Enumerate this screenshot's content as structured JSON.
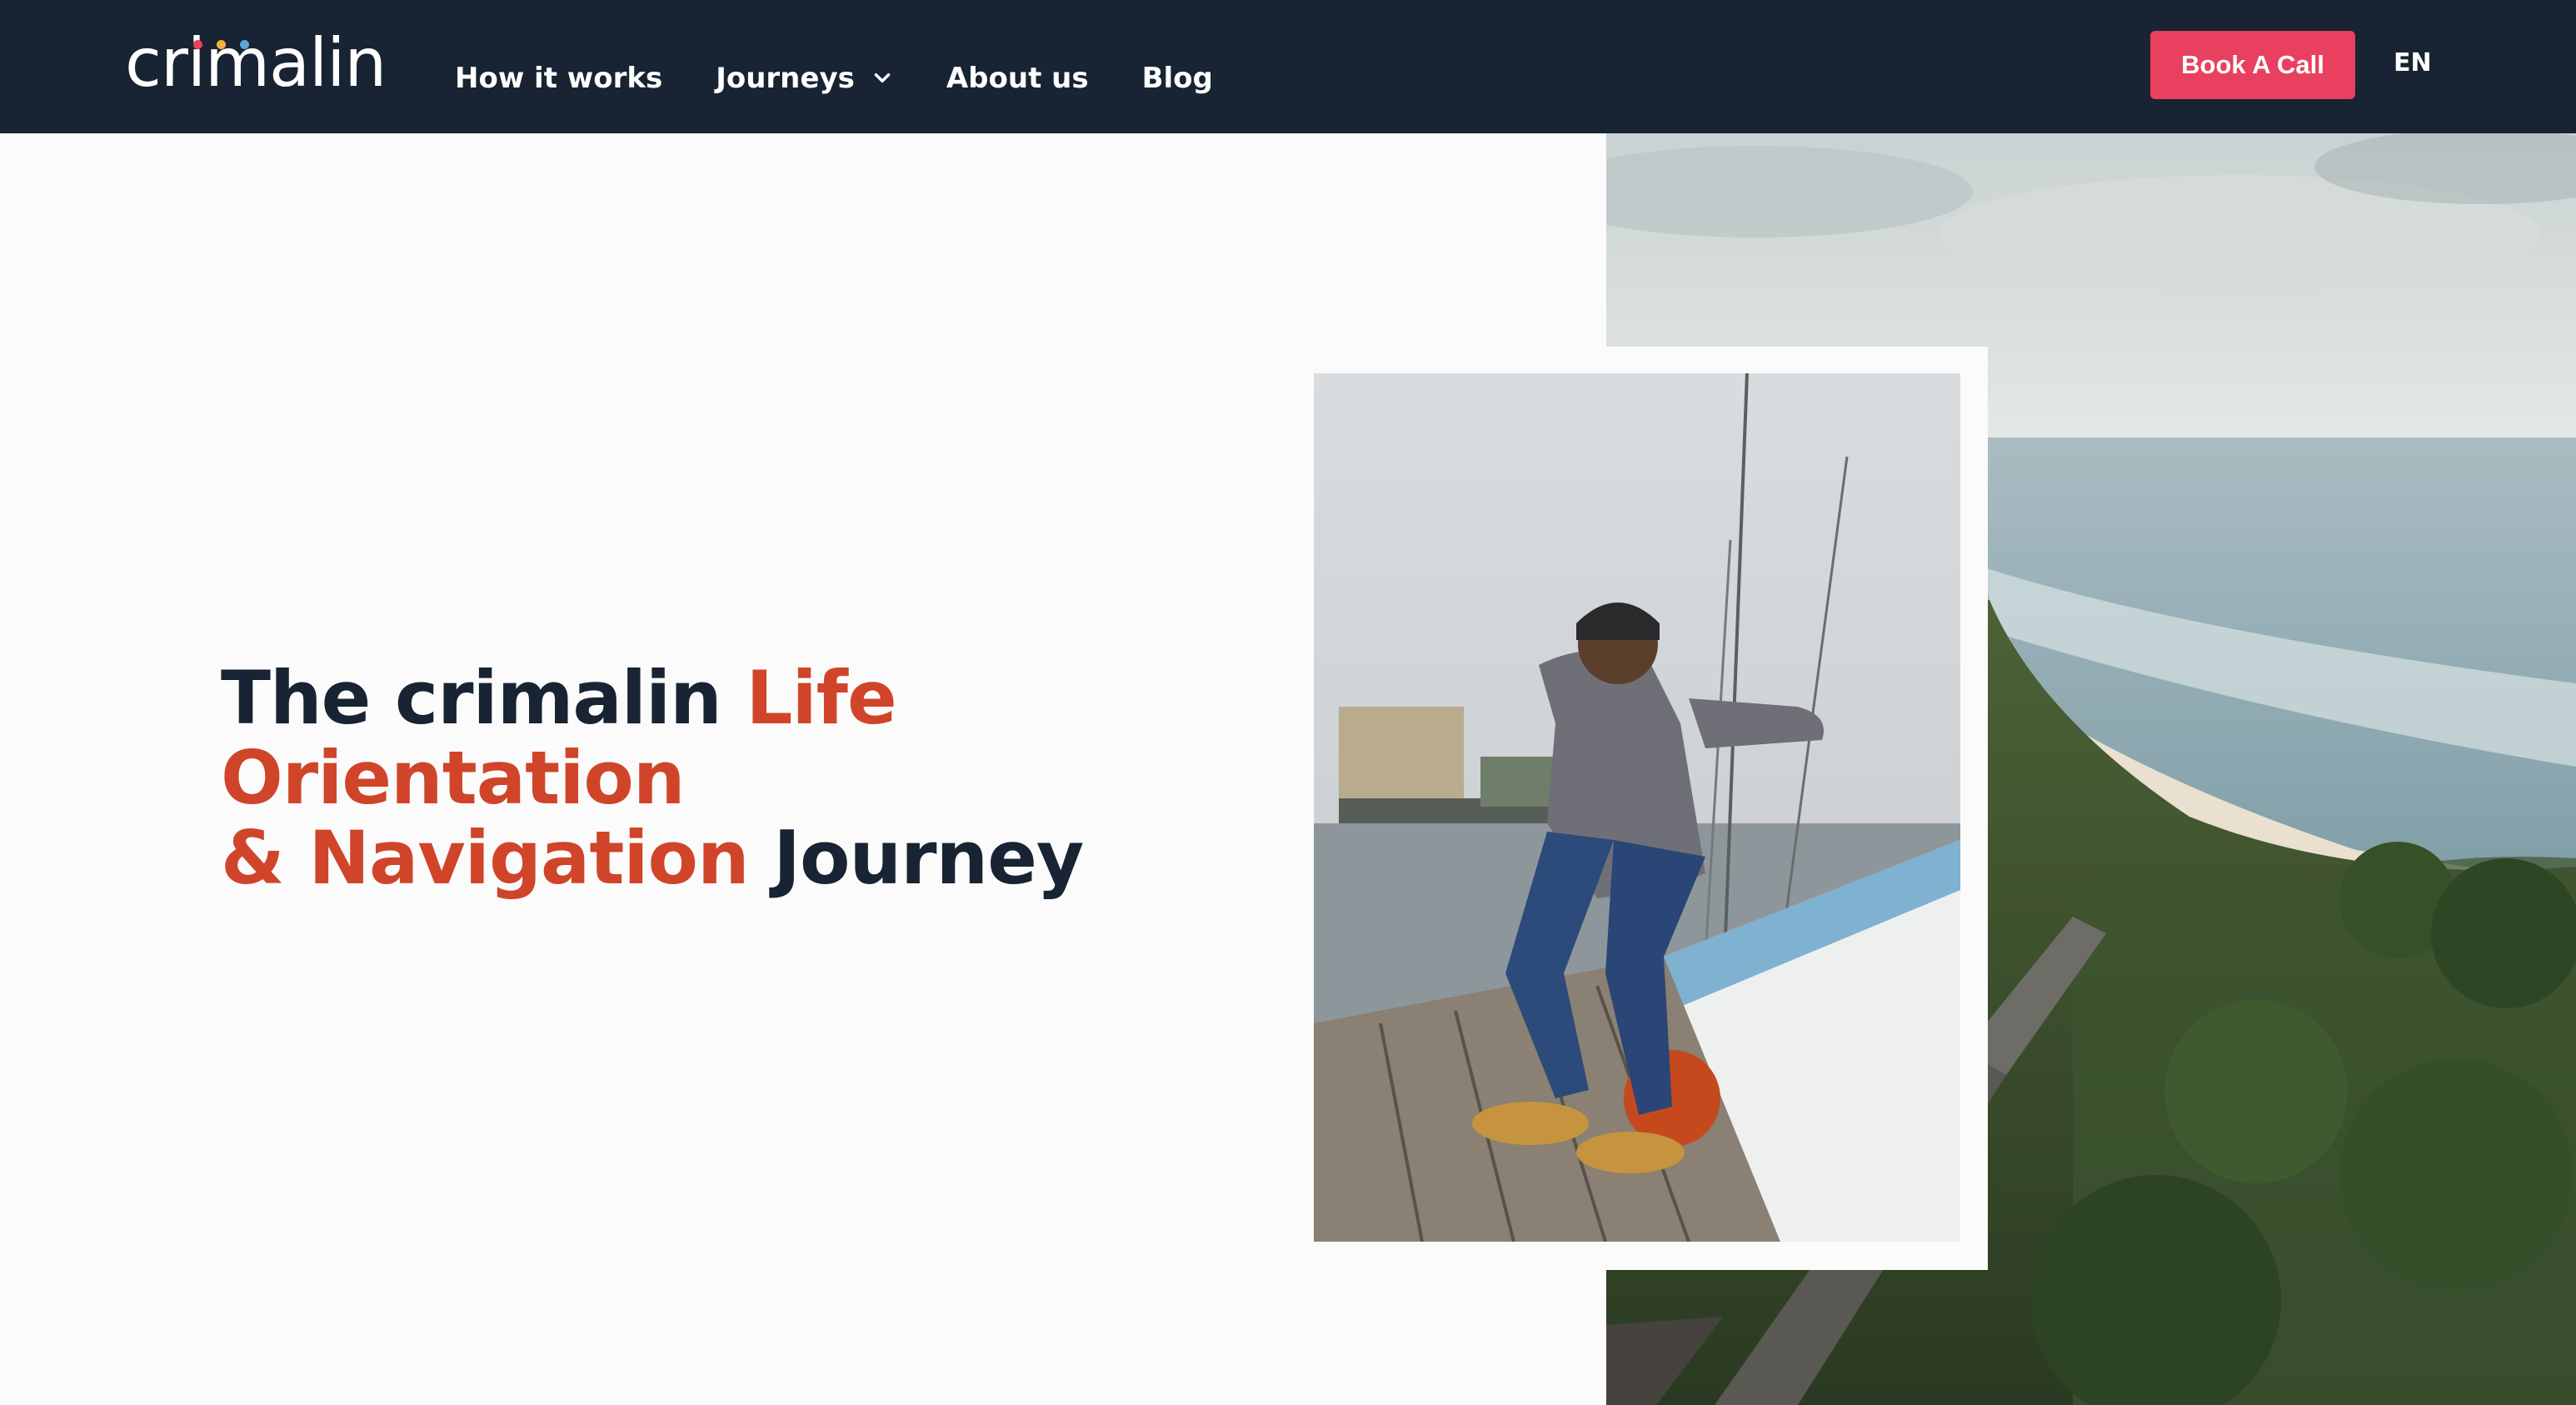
{
  "header": {
    "logo_text": "crimalin",
    "nav": [
      {
        "label": "How it works"
      },
      {
        "label": "Journeys",
        "has_dropdown": true
      },
      {
        "label": "About us"
      },
      {
        "label": "Blog"
      }
    ],
    "cta_label": "Book A Call",
    "language": "EN"
  },
  "hero": {
    "title_part1": "The crimalin ",
    "title_accent1": "Life Orientation",
    "title_accent2": "& Navigation",
    "title_part2": " Journey"
  },
  "icons": {
    "dropdown": "chevron-down-icon"
  },
  "colors": {
    "header_bg": "#182333",
    "cta_bg": "#e8405e",
    "accent": "#d0452a",
    "text_dark": "#182333",
    "logo_dots": [
      "#e8405e",
      "#f2b33d",
      "#5aa6d6"
    ]
  }
}
